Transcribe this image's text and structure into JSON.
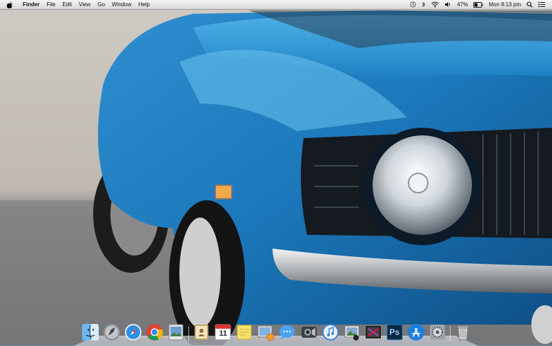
{
  "menubar": {
    "app_name": "Finder",
    "menus": [
      "File",
      "Edit",
      "View",
      "Go",
      "Window",
      "Help"
    ],
    "status": {
      "battery_percent": "47%",
      "clock": "Mon 8:13 pm"
    }
  },
  "dock": {
    "calendar_day": "11",
    "photoshop_label": "Ps"
  },
  "colors": {
    "car_blue": "#1e7fc4",
    "menubar_bg": "#e6e6e6"
  }
}
